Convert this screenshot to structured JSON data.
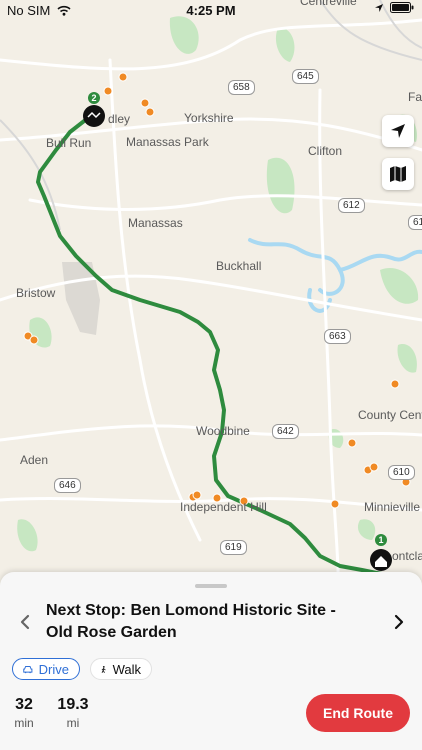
{
  "status": {
    "carrier": "No SIM",
    "time": "4:25 PM"
  },
  "map": {
    "labels": {
      "centreville": "Centreville",
      "yorkshire": "Yorkshire",
      "manassas_park": "Manassas Park",
      "bull_run": "Bull Run",
      "manassas": "Manassas",
      "clifton": "Clifton",
      "buckhall": "Buckhall",
      "bristow": "Bristow",
      "woodbine": "Woodbine",
      "aden": "Aden",
      "county_center": "County Cent",
      "independent_hill": "Independent Hill",
      "minnieville": "Minnieville",
      "montclair": "ontclair",
      "bradley": "dley",
      "fair": "Fai"
    },
    "shields": [
      "645",
      "658",
      "612",
      "663",
      "642",
      "610",
      "646",
      "619",
      "61"
    ],
    "markers": {
      "start": "2",
      "end": "1"
    },
    "colors": {
      "route": "#2e8b3e",
      "poi": "#f08a24",
      "water": "#a9d9f2",
      "park": "#c7e7c2"
    }
  },
  "sheet": {
    "next_stop": "Next Stop: Ben Lomond Historic Site - Old Rose Garden",
    "modes": {
      "drive": "Drive",
      "walk": "Walk",
      "selected": "Drive"
    },
    "stats": {
      "time_value": "32",
      "time_unit": "min",
      "distance_value": "19.3",
      "distance_unit": "mi"
    },
    "end_button": "End Route",
    "accent": "#e23a3f"
  }
}
